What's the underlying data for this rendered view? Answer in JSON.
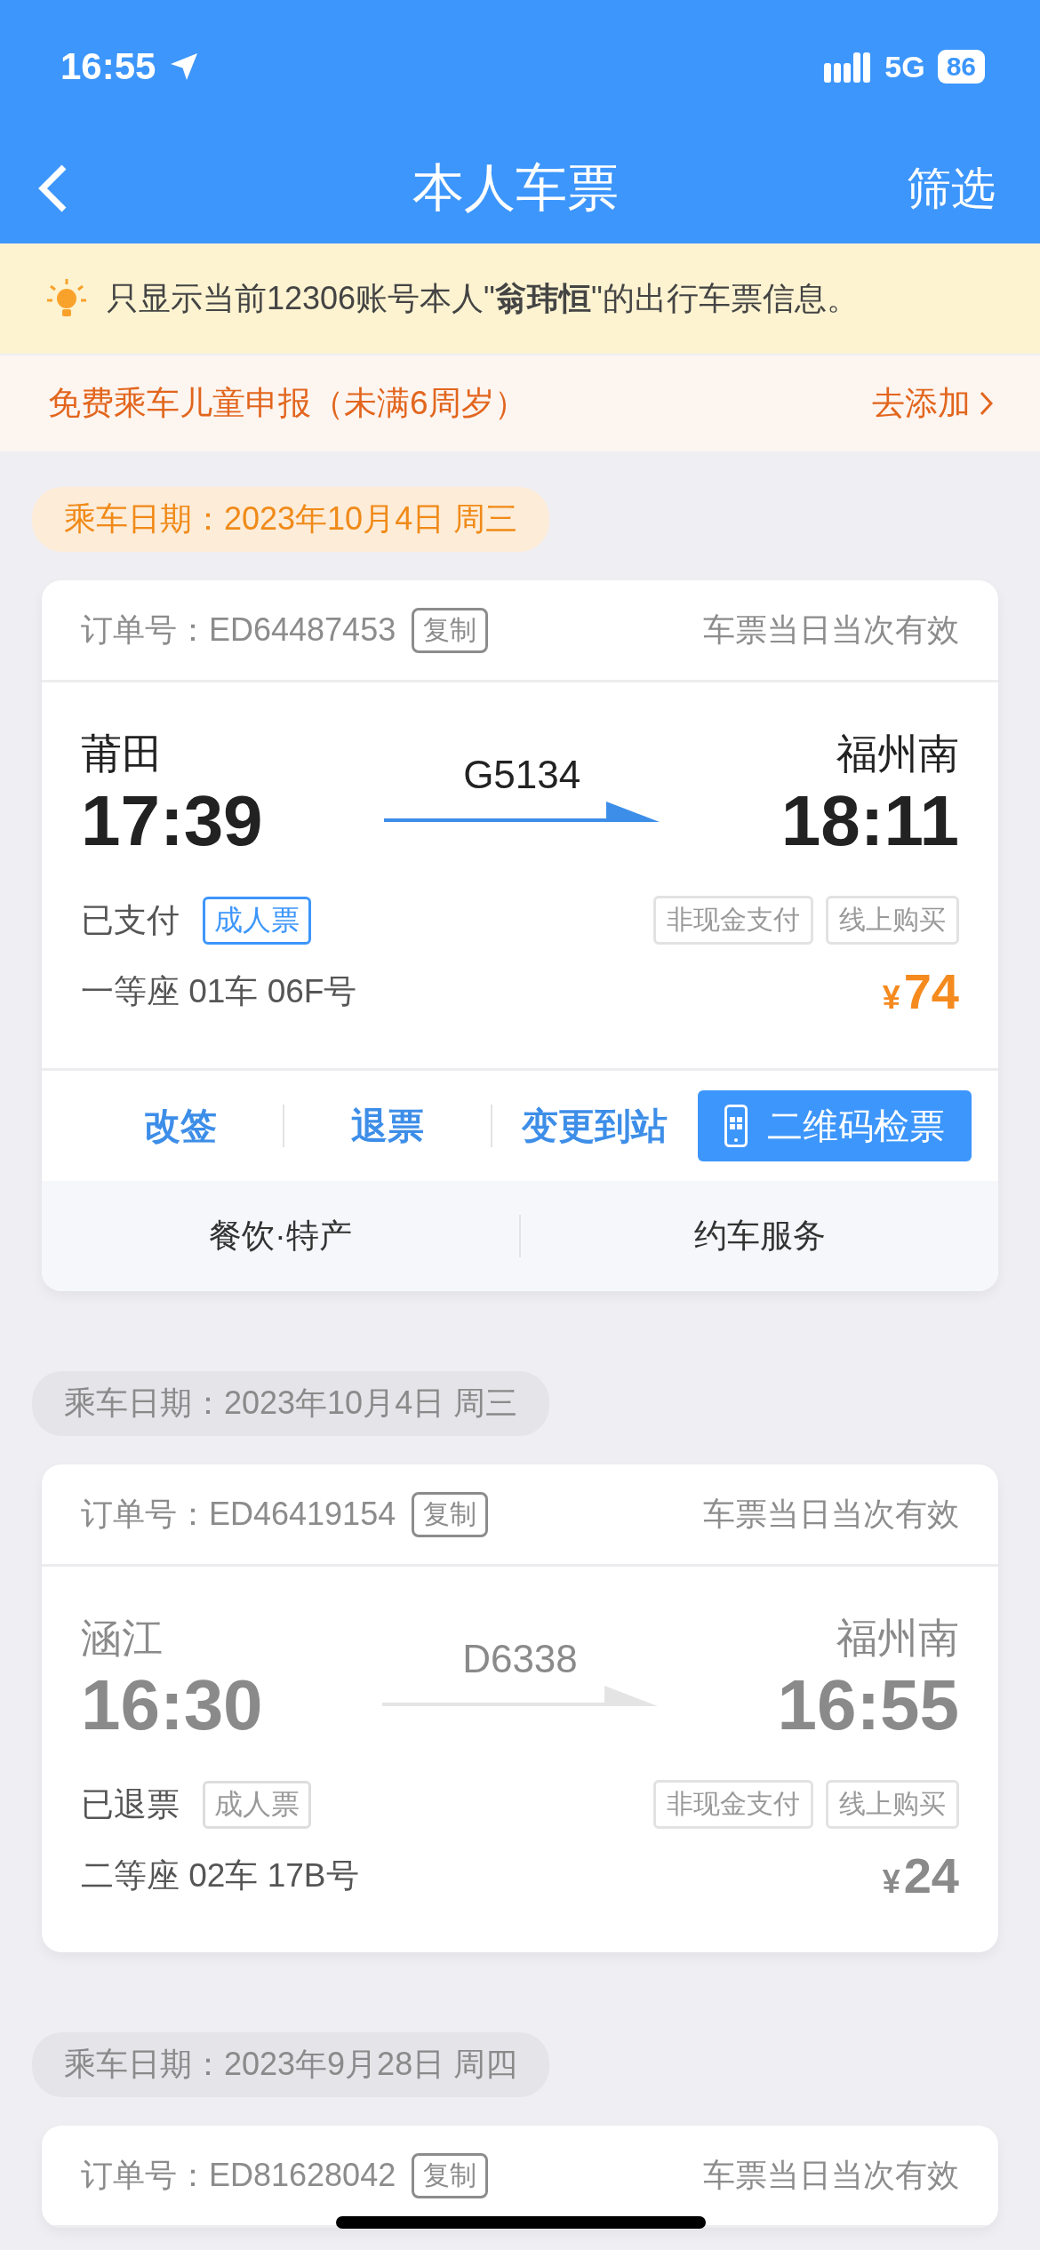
{
  "status_bar": {
    "time": "16:55",
    "network": "5G",
    "battery": "86"
  },
  "nav": {
    "title": "本人车票",
    "filter": "筛选"
  },
  "notice": {
    "text": "只显示当前12306账号本人\"**翁玮恒**\"的出行车票信息。"
  },
  "child_banner": {
    "text": "免费乘车儿童申报（未满6周岁）",
    "action": "去添加"
  },
  "trips": [
    {
      "date": "乘车日期：2023年10月4日 周三",
      "refunded": false,
      "order_label": "订单号：",
      "order_no": "ED64487453",
      "copy": "复制",
      "validity": "车票当日当次有效",
      "from": "莆田",
      "depart": "17:39",
      "train": "G5134",
      "to": "福州南",
      "arrive": "18:11",
      "status": "已支付",
      "ticket_type": "成人票",
      "tags": [
        "非现金支付",
        "线上购买"
      ],
      "seat": "一等座 01车 06F号",
      "currency": "¥",
      "price": "74",
      "actions": [
        {
          "kind": "link",
          "label": "改签"
        },
        {
          "kind": "link",
          "label": "退票"
        },
        {
          "kind": "link",
          "label": "变更到站"
        },
        {
          "kind": "primary",
          "label": "二维码检票"
        }
      ],
      "services": [
        "餐饮·特产",
        "约车服务"
      ]
    },
    {
      "date": "乘车日期：2023年10月4日 周三",
      "refunded": true,
      "order_label": "订单号：",
      "order_no": "ED46419154",
      "copy": "复制",
      "validity": "车票当日当次有效",
      "from": "涵江",
      "depart": "16:30",
      "train": "D6338",
      "to": "福州南",
      "arrive": "16:55",
      "status": "已退票",
      "ticket_type": "成人票",
      "tags": [
        "非现金支付",
        "线上购买"
      ],
      "seat": "二等座 02车 17B号",
      "currency": "¥",
      "price": "24"
    },
    {
      "date": "乘车日期：2023年9月28日 周四",
      "refunded": true,
      "order_label": "订单号：",
      "order_no": "ED81628042",
      "copy": "复制",
      "validity": "车票当日当次有效"
    }
  ]
}
